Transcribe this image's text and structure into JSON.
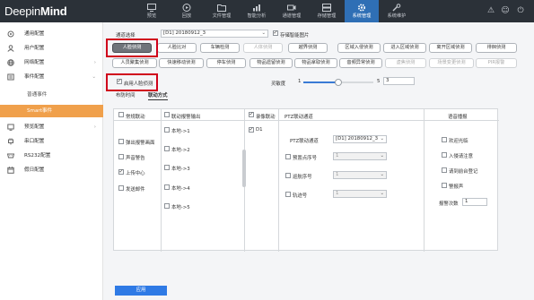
{
  "app": {
    "logo_prefix": "Deepin",
    "logo_suffix": "Mind"
  },
  "nav": [
    {
      "label": "预览",
      "icon": "monitor-icon",
      "active": false
    },
    {
      "label": "回放",
      "icon": "playback-icon",
      "active": false
    },
    {
      "label": "文件管理",
      "icon": "file-icon",
      "active": false
    },
    {
      "label": "智能分析",
      "icon": "chart-icon",
      "active": false
    },
    {
      "label": "通道管理",
      "icon": "camera-icon",
      "active": false
    },
    {
      "label": "存储管理",
      "icon": "storage-icon",
      "active": false
    },
    {
      "label": "系统管理",
      "icon": "gear-icon",
      "active": true
    },
    {
      "label": "系统维护",
      "icon": "wrench-icon",
      "active": false
    }
  ],
  "top_right_icons": [
    "bell-icon",
    "user-icon",
    "power-icon"
  ],
  "sidebar": {
    "items": [
      {
        "label": "通用配置",
        "icon": "gear-icon",
        "expand": ""
      },
      {
        "label": "用户配置",
        "icon": "user-icon",
        "expand": ""
      },
      {
        "label": "网络配置",
        "icon": "globe-icon",
        "expand": "›"
      },
      {
        "label": "事件配置",
        "icon": "event-icon",
        "expand": "⌄"
      }
    ],
    "subitems": [
      {
        "label": "普通事件",
        "active": false
      },
      {
        "label": "Smart事件",
        "active": true
      }
    ],
    "items2": [
      {
        "label": "预览配置",
        "icon": "preview-icon",
        "expand": "›"
      },
      {
        "label": "串口配置",
        "icon": "plug-icon",
        "expand": ""
      },
      {
        "label": "RS232配置",
        "icon": "port-icon",
        "expand": ""
      },
      {
        "label": "假日配置",
        "icon": "calendar-icon",
        "expand": ""
      }
    ]
  },
  "channel": {
    "label": "通道选择",
    "value": "[D1] 20180912_3",
    "store_label": "存储智能图片"
  },
  "detect_buttons": [
    [
      {
        "label": "人脸侦测",
        "state": "selected"
      },
      {
        "label": "人脸比对",
        "state": "normal"
      },
      {
        "label": "车辆检测",
        "state": "normal"
      },
      {
        "label": "人体侦测",
        "state": "disabled"
      },
      {
        "label": "越界侦测",
        "state": "normal"
      },
      {
        "label": "区域入侵侦测",
        "state": "normal"
      },
      {
        "label": "进入区域侦测",
        "state": "normal"
      },
      {
        "label": "离开区域侦测",
        "state": "normal"
      },
      {
        "label": "徘徊侦测",
        "state": "normal"
      }
    ],
    [
      {
        "label": "人员聚集侦测",
        "state": "normal"
      },
      {
        "label": "快速移动侦测",
        "state": "normal"
      },
      {
        "label": "停车侦测",
        "state": "normal"
      },
      {
        "label": "物品遗留侦测",
        "state": "normal"
      },
      {
        "label": "物品拿取侦测",
        "state": "normal"
      },
      {
        "label": "音频异常侦测",
        "state": "normal"
      },
      {
        "label": "虚焦侦测",
        "state": "disabled"
      },
      {
        "label": "场景变更侦测",
        "state": "disabled"
      },
      {
        "label": "PIR报警",
        "state": "disabled"
      }
    ]
  ],
  "enable_face": {
    "label": "启用人脸侦测",
    "checked": true
  },
  "sensitivity": {
    "label": "灵敏度",
    "min": "1",
    "max": "5",
    "value": "3",
    "fraction": 0.5
  },
  "tabs": [
    {
      "label": "布防时间",
      "active": false
    },
    {
      "label": "联动方式",
      "active": true
    }
  ],
  "linkage": {
    "col1": {
      "header": "常规联动",
      "items": [
        {
          "label": "弹出报警画面",
          "checked": false
        },
        {
          "label": "声音警告",
          "checked": false
        },
        {
          "label": "上传中心",
          "checked": true
        },
        {
          "label": "发送邮件",
          "checked": false
        }
      ]
    },
    "col2": {
      "header": "联动报警输出",
      "items": [
        {
          "label": "本地->1"
        },
        {
          "label": "本地->2"
        },
        {
          "label": "本地->3"
        },
        {
          "label": "本地->4"
        },
        {
          "label": "本地->5"
        }
      ]
    },
    "col3": {
      "header": "录像联动",
      "items": [
        {
          "label": "D1",
          "checked": true
        }
      ]
    },
    "ptz": {
      "header": "PTZ联动通道",
      "channel_label": "PTZ联动通道",
      "channel_value": "[D1] 20180912_3",
      "rows": [
        {
          "label": "预置点序号",
          "value": "1"
        },
        {
          "label": "巡航序号",
          "value": "1"
        },
        {
          "label": "轨迹号",
          "value": "1"
        }
      ]
    },
    "voice": {
      "header": "语音播报",
      "items": [
        {
          "label": "欢迎光临"
        },
        {
          "label": "入侵请注意"
        },
        {
          "label": "请到前台登记"
        },
        {
          "label": "警报声"
        }
      ],
      "count_label": "报警次数",
      "count_value": "1"
    }
  },
  "apply_label": "应用"
}
